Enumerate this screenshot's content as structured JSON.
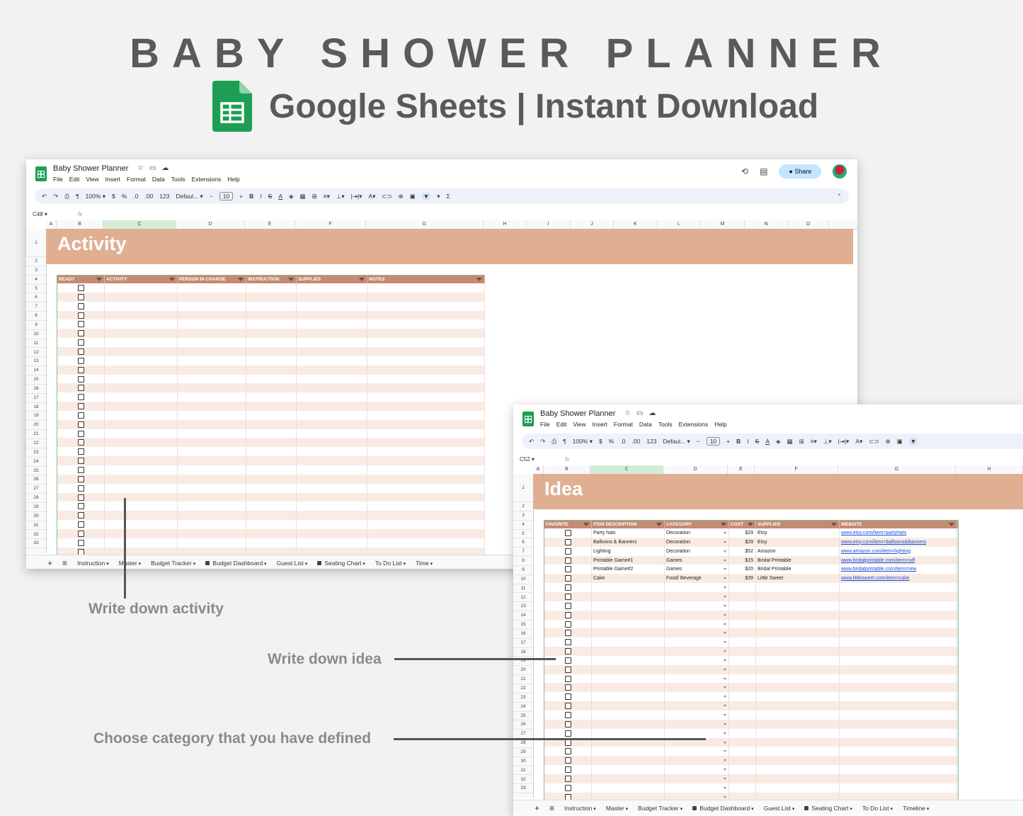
{
  "hero": {
    "title": "BABY SHOWER PLANNER",
    "subtitle": "Google Sheets | Instant Download"
  },
  "app": {
    "doc_title": "Baby Shower Planner",
    "menu": [
      "File",
      "Edit",
      "View",
      "Insert",
      "Format",
      "Data",
      "Tools",
      "Extensions",
      "Help"
    ],
    "share_label": "Share",
    "zoom": "100%",
    "font": "Defaul...",
    "font_size": "10",
    "number_fmt": "123"
  },
  "sheet1": {
    "name_box": "C48",
    "columns": [
      "A",
      "B",
      "C",
      "D",
      "E",
      "F",
      "G",
      "H",
      "I",
      "J",
      "K",
      "L",
      "M",
      "N",
      "O"
    ],
    "banner": "Activity",
    "headers": [
      "READY",
      "ACTIVITY",
      "PERSON IN CHARGE",
      "INSTRUCTION",
      "SUPPLIES",
      "NOTES"
    ],
    "rows": [
      "1",
      "2",
      "3",
      "4",
      "5",
      "6",
      "7",
      "8",
      "9",
      "10",
      "11",
      "12",
      "13",
      "14",
      "15",
      "16",
      "17",
      "18",
      "19",
      "20",
      "21",
      "22",
      "23",
      "24",
      "25",
      "26",
      "27",
      "28",
      "29",
      "30",
      "31",
      "32",
      "33"
    ]
  },
  "sheet2": {
    "name_box": "C52",
    "columns": [
      "A",
      "B",
      "C",
      "D",
      "E",
      "F",
      "G",
      "H"
    ],
    "banner": "Idea",
    "headers": [
      "FAVORITE",
      "ITEM DESCRIPTION",
      "CATEGORY",
      "COST",
      "SUPPLIER",
      "WEBSITE"
    ],
    "items": [
      {
        "desc": "Party hats",
        "category": "Decoration",
        "cost": "$29",
        "supplier": "Etsy",
        "website": "www.etsy.com/item=partyhats"
      },
      {
        "desc": "Balloons & Banners",
        "category": "Decoration",
        "cost": "$29",
        "supplier": "Etsy",
        "website": "www.etsy.com/item=balloons&Banners"
      },
      {
        "desc": "Lighting",
        "category": "Decoration",
        "cost": "$52",
        "supplier": "Amazon",
        "website": "www.amazon.com/item=lighting"
      },
      {
        "desc": "Printable Game#1",
        "category": "Games",
        "cost": "$15",
        "supplier": "Bridal Printable",
        "website": "www.bridalprintable.com/item=sdf"
      },
      {
        "desc": "Printable Game#2",
        "category": "Games",
        "cost": "$20",
        "supplier": "Bridal Printable",
        "website": "www.bridalprintable.com/item=rew"
      },
      {
        "desc": "Cake",
        "category": "Food/ Beverage",
        "cost": "$39",
        "supplier": "Little Sweet",
        "website": "www.littlesweet.com/item=cake"
      }
    ]
  },
  "tabs1": [
    "Instruction",
    "Master",
    "Budget Tracker",
    "Budget Dashboard",
    "Guest List",
    "Seating Chart",
    "To Do List",
    "Time"
  ],
  "tabs2": [
    "Instruction",
    "Master",
    "Budget Tracker",
    "Budget Dashboard",
    "Guest List",
    "Seating Chart",
    "To Do List",
    "Timeline"
  ],
  "callouts": {
    "activity": "Write down activity",
    "idea": "Write down idea",
    "category": "Choose category that you have defined"
  },
  "colors": {
    "banner": "#e0af92",
    "header": "#c48a72",
    "stripe": "#f9ebe3",
    "sheets_green": "#1e9e55"
  }
}
